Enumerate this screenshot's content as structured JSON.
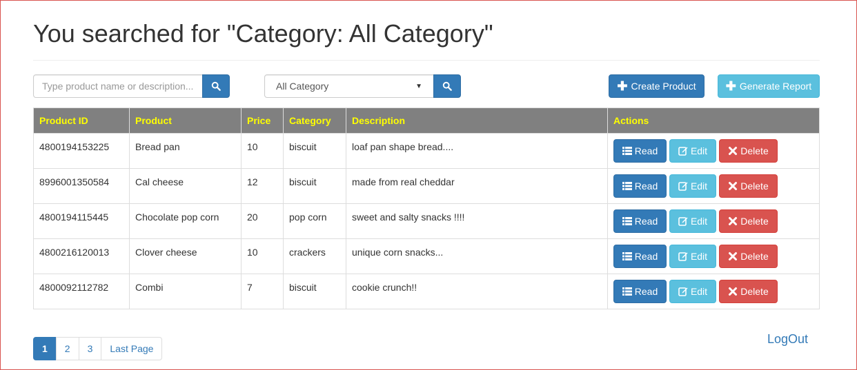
{
  "page": {
    "title": "You searched for \"Category: All Category\""
  },
  "search": {
    "placeholder": "Type product name or description...",
    "value": ""
  },
  "category_filter": {
    "selected": "All Category"
  },
  "toolbar": {
    "create_label": "Create Product",
    "report_label": "Generate Report"
  },
  "table": {
    "headers": [
      "Product ID",
      "Product",
      "Price",
      "Category",
      "Description",
      "Actions"
    ],
    "rows": [
      {
        "id": "4800194153225",
        "product": "Bread pan",
        "price": "10",
        "category": "biscuit",
        "description": "loaf pan shape bread...."
      },
      {
        "id": "8996001350584",
        "product": "Cal cheese",
        "price": "12",
        "category": "biscuit",
        "description": "made from real cheddar"
      },
      {
        "id": "4800194115445",
        "product": "Chocolate pop corn",
        "price": "20",
        "category": "pop corn",
        "description": "sweet and salty snacks !!!!"
      },
      {
        "id": "4800216120013",
        "product": "Clover cheese",
        "price": "10",
        "category": "crackers",
        "description": "unique corn snacks..."
      },
      {
        "id": "4800092112782",
        "product": "Combi",
        "price": "7",
        "category": "biscuit",
        "description": "cookie crunch!!"
      }
    ],
    "actions": {
      "read_label": "Read",
      "edit_label": "Edit",
      "delete_label": "Delete"
    }
  },
  "pagination": {
    "pages": [
      "1",
      "2",
      "3"
    ],
    "active": "1",
    "last_label": "Last Page"
  },
  "footer": {
    "logout_label": "LogOut"
  },
  "colors": {
    "primary": "#337ab7",
    "info": "#5bc0de",
    "danger": "#d9534f",
    "header_bg": "#808080",
    "header_text": "#ffff00"
  },
  "icons": [
    "search-icon",
    "plus-icon",
    "list-icon",
    "edit-icon",
    "times-icon"
  ]
}
